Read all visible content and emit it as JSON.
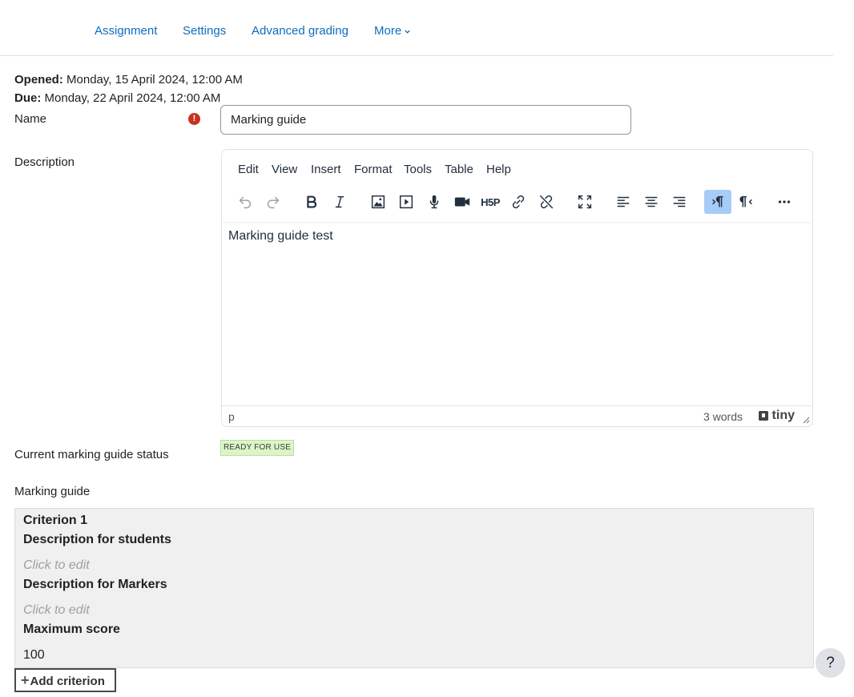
{
  "nav": {
    "items": [
      {
        "label": "Assignment"
      },
      {
        "label": "Settings"
      },
      {
        "label": "Advanced grading"
      },
      {
        "label": "More"
      }
    ]
  },
  "dates": {
    "opened_label": "Opened:",
    "opened_value": "Monday, 15 April 2024, 12:00 AM",
    "due_label": "Due:",
    "due_value": "Monday, 22 April 2024, 12:00 AM"
  },
  "form": {
    "name_label": "Name",
    "name_value": "Marking guide",
    "description_label": "Description",
    "status_label": "Current marking guide status",
    "status_badge": "READY FOR USE",
    "guide_label": "Marking guide"
  },
  "editor": {
    "menus": [
      "Edit",
      "View",
      "Insert",
      "Format",
      "Tools",
      "Table",
      "Help"
    ],
    "content": "Marking guide test",
    "path": "p",
    "word_count": "3 words",
    "brand": "tiny",
    "icons": [
      "undo-icon",
      "redo-icon",
      "bold-icon",
      "italic-icon",
      "image-icon",
      "media-icon",
      "microphone-icon",
      "video-camera-icon",
      "h5p-icon",
      "link-icon",
      "unlink-icon",
      "fullscreen-icon",
      "align-left-icon",
      "align-center-icon",
      "align-right-icon",
      "ltr-icon",
      "rtl-icon",
      "more-icon"
    ],
    "h5p_text": "H5P"
  },
  "criterion": {
    "title": "Criterion 1",
    "students_label": "Description for students",
    "students_placeholder": "Click to edit",
    "markers_label": "Description for Markers",
    "markers_placeholder": "Click to edit",
    "max_label": "Maximum score",
    "max_value": "100"
  },
  "buttons": {
    "add_criterion": "Add criterion",
    "help": "?"
  },
  "colors": {
    "link": "#0f6cbf",
    "required": "#ca3120",
    "badge_bg": "#dcf5c8",
    "active_button": "#a6ccf7"
  }
}
